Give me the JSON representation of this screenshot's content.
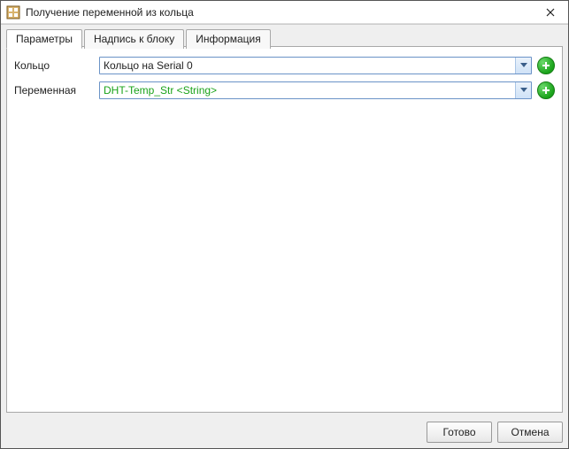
{
  "window": {
    "title": "Получение переменной из кольца"
  },
  "tabs": {
    "params": "Параметры",
    "label": "Надпись к блоку",
    "info": "Информация"
  },
  "form": {
    "ring_label": "Кольцо",
    "ring_value": "Кольцо  на Serial 0",
    "var_label": "Переменная",
    "var_value": "DHT-Temp_Str <String>"
  },
  "buttons": {
    "ok": "Готово",
    "cancel": "Отмена"
  }
}
